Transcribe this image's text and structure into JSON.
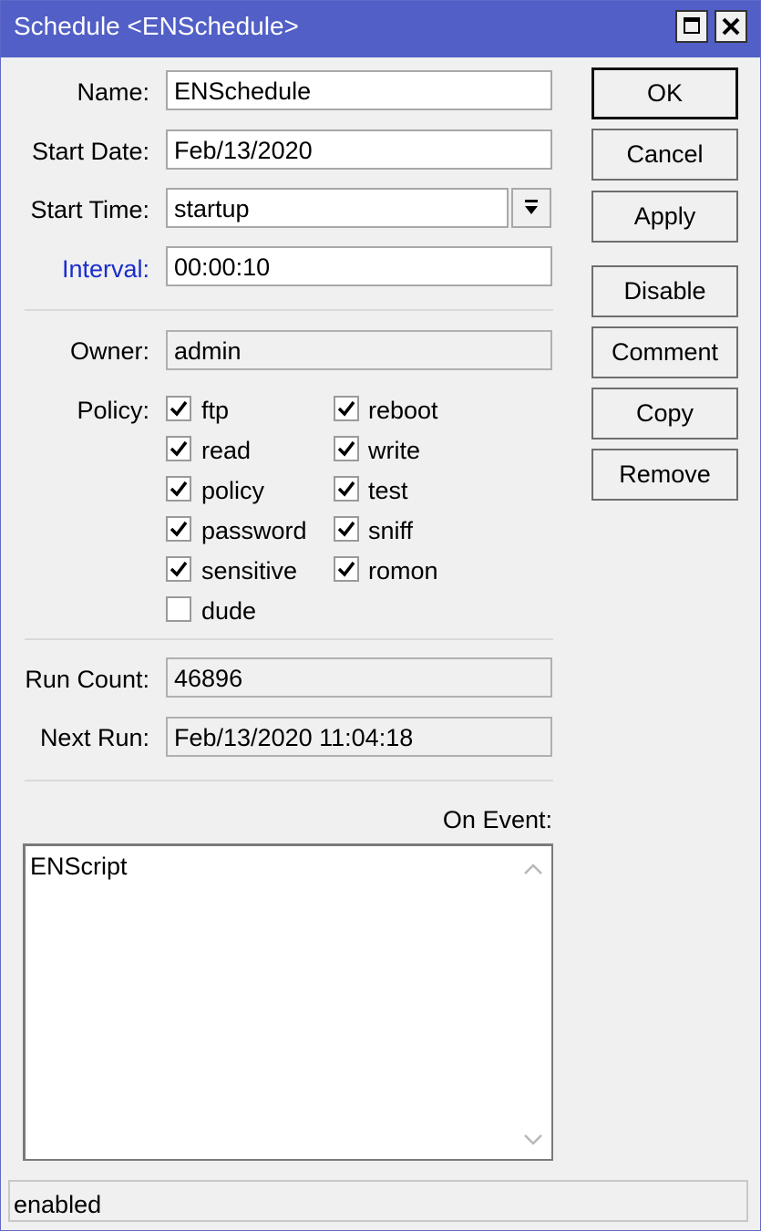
{
  "window": {
    "title": "Schedule <ENSchedule>",
    "maximize_icon": "maximize-icon",
    "close_icon": "close-icon"
  },
  "form": {
    "name": {
      "label": "Name:",
      "value": "ENSchedule"
    },
    "start_date": {
      "label": "Start Date:",
      "value": "Feb/13/2020"
    },
    "start_time": {
      "label": "Start Time:",
      "value": "startup",
      "dropdown_icon": "dropdown-arrow-icon"
    },
    "interval": {
      "label": "Interval:",
      "value": "00:00:10",
      "label_color": "#1a2dcc"
    },
    "owner": {
      "label": "Owner:",
      "value": "admin"
    },
    "policy": {
      "label": "Policy:",
      "items": [
        {
          "label": "ftp",
          "checked": true
        },
        {
          "label": "reboot",
          "checked": true
        },
        {
          "label": "read",
          "checked": true
        },
        {
          "label": "write",
          "checked": true
        },
        {
          "label": "policy",
          "checked": true
        },
        {
          "label": "test",
          "checked": true
        },
        {
          "label": "password",
          "checked": true
        },
        {
          "label": "sniff",
          "checked": true
        },
        {
          "label": "sensitive",
          "checked": true
        },
        {
          "label": "romon",
          "checked": true
        },
        {
          "label": "dude",
          "checked": false
        }
      ]
    },
    "run_count": {
      "label": "Run Count:",
      "value": "46896"
    },
    "next_run": {
      "label": "Next Run:",
      "value": "Feb/13/2020 11:04:18"
    },
    "on_event": {
      "label": "On Event:",
      "value": "ENScript"
    }
  },
  "buttons": {
    "ok": "OK",
    "cancel": "Cancel",
    "apply": "Apply",
    "disable": "Disable",
    "comment": "Comment",
    "copy": "Copy",
    "remove": "Remove"
  },
  "status": {
    "text": "enabled"
  },
  "colors": {
    "titlebar": "#515fc6",
    "accent_label": "#1a2dcc",
    "background": "#f0f0f0"
  }
}
